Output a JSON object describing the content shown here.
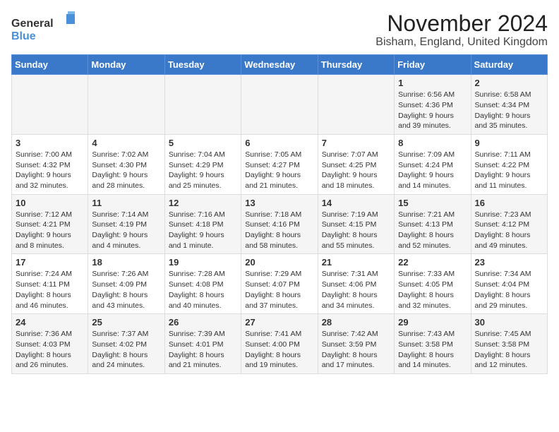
{
  "logo": {
    "text_general": "General",
    "text_blue": "Blue"
  },
  "title": "November 2024",
  "subtitle": "Bisham, England, United Kingdom",
  "columns": [
    "Sunday",
    "Monday",
    "Tuesday",
    "Wednesday",
    "Thursday",
    "Friday",
    "Saturday"
  ],
  "weeks": [
    [
      {
        "day": "",
        "sunrise": "",
        "sunset": "",
        "daylight": ""
      },
      {
        "day": "",
        "sunrise": "",
        "sunset": "",
        "daylight": ""
      },
      {
        "day": "",
        "sunrise": "",
        "sunset": "",
        "daylight": ""
      },
      {
        "day": "",
        "sunrise": "",
        "sunset": "",
        "daylight": ""
      },
      {
        "day": "",
        "sunrise": "",
        "sunset": "",
        "daylight": ""
      },
      {
        "day": "1",
        "sunrise": "Sunrise: 6:56 AM",
        "sunset": "Sunset: 4:36 PM",
        "daylight": "Daylight: 9 hours and 39 minutes."
      },
      {
        "day": "2",
        "sunrise": "Sunrise: 6:58 AM",
        "sunset": "Sunset: 4:34 PM",
        "daylight": "Daylight: 9 hours and 35 minutes."
      }
    ],
    [
      {
        "day": "3",
        "sunrise": "Sunrise: 7:00 AM",
        "sunset": "Sunset: 4:32 PM",
        "daylight": "Daylight: 9 hours and 32 minutes."
      },
      {
        "day": "4",
        "sunrise": "Sunrise: 7:02 AM",
        "sunset": "Sunset: 4:30 PM",
        "daylight": "Daylight: 9 hours and 28 minutes."
      },
      {
        "day": "5",
        "sunrise": "Sunrise: 7:04 AM",
        "sunset": "Sunset: 4:29 PM",
        "daylight": "Daylight: 9 hours and 25 minutes."
      },
      {
        "day": "6",
        "sunrise": "Sunrise: 7:05 AM",
        "sunset": "Sunset: 4:27 PM",
        "daylight": "Daylight: 9 hours and 21 minutes."
      },
      {
        "day": "7",
        "sunrise": "Sunrise: 7:07 AM",
        "sunset": "Sunset: 4:25 PM",
        "daylight": "Daylight: 9 hours and 18 minutes."
      },
      {
        "day": "8",
        "sunrise": "Sunrise: 7:09 AM",
        "sunset": "Sunset: 4:24 PM",
        "daylight": "Daylight: 9 hours and 14 minutes."
      },
      {
        "day": "9",
        "sunrise": "Sunrise: 7:11 AM",
        "sunset": "Sunset: 4:22 PM",
        "daylight": "Daylight: 9 hours and 11 minutes."
      }
    ],
    [
      {
        "day": "10",
        "sunrise": "Sunrise: 7:12 AM",
        "sunset": "Sunset: 4:21 PM",
        "daylight": "Daylight: 9 hours and 8 minutes."
      },
      {
        "day": "11",
        "sunrise": "Sunrise: 7:14 AM",
        "sunset": "Sunset: 4:19 PM",
        "daylight": "Daylight: 9 hours and 4 minutes."
      },
      {
        "day": "12",
        "sunrise": "Sunrise: 7:16 AM",
        "sunset": "Sunset: 4:18 PM",
        "daylight": "Daylight: 9 hours and 1 minute."
      },
      {
        "day": "13",
        "sunrise": "Sunrise: 7:18 AM",
        "sunset": "Sunset: 4:16 PM",
        "daylight": "Daylight: 8 hours and 58 minutes."
      },
      {
        "day": "14",
        "sunrise": "Sunrise: 7:19 AM",
        "sunset": "Sunset: 4:15 PM",
        "daylight": "Daylight: 8 hours and 55 minutes."
      },
      {
        "day": "15",
        "sunrise": "Sunrise: 7:21 AM",
        "sunset": "Sunset: 4:13 PM",
        "daylight": "Daylight: 8 hours and 52 minutes."
      },
      {
        "day": "16",
        "sunrise": "Sunrise: 7:23 AM",
        "sunset": "Sunset: 4:12 PM",
        "daylight": "Daylight: 8 hours and 49 minutes."
      }
    ],
    [
      {
        "day": "17",
        "sunrise": "Sunrise: 7:24 AM",
        "sunset": "Sunset: 4:11 PM",
        "daylight": "Daylight: 8 hours and 46 minutes."
      },
      {
        "day": "18",
        "sunrise": "Sunrise: 7:26 AM",
        "sunset": "Sunset: 4:09 PM",
        "daylight": "Daylight: 8 hours and 43 minutes."
      },
      {
        "day": "19",
        "sunrise": "Sunrise: 7:28 AM",
        "sunset": "Sunset: 4:08 PM",
        "daylight": "Daylight: 8 hours and 40 minutes."
      },
      {
        "day": "20",
        "sunrise": "Sunrise: 7:29 AM",
        "sunset": "Sunset: 4:07 PM",
        "daylight": "Daylight: 8 hours and 37 minutes."
      },
      {
        "day": "21",
        "sunrise": "Sunrise: 7:31 AM",
        "sunset": "Sunset: 4:06 PM",
        "daylight": "Daylight: 8 hours and 34 minutes."
      },
      {
        "day": "22",
        "sunrise": "Sunrise: 7:33 AM",
        "sunset": "Sunset: 4:05 PM",
        "daylight": "Daylight: 8 hours and 32 minutes."
      },
      {
        "day": "23",
        "sunrise": "Sunrise: 7:34 AM",
        "sunset": "Sunset: 4:04 PM",
        "daylight": "Daylight: 8 hours and 29 minutes."
      }
    ],
    [
      {
        "day": "24",
        "sunrise": "Sunrise: 7:36 AM",
        "sunset": "Sunset: 4:03 PM",
        "daylight": "Daylight: 8 hours and 26 minutes."
      },
      {
        "day": "25",
        "sunrise": "Sunrise: 7:37 AM",
        "sunset": "Sunset: 4:02 PM",
        "daylight": "Daylight: 8 hours and 24 minutes."
      },
      {
        "day": "26",
        "sunrise": "Sunrise: 7:39 AM",
        "sunset": "Sunset: 4:01 PM",
        "daylight": "Daylight: 8 hours and 21 minutes."
      },
      {
        "day": "27",
        "sunrise": "Sunrise: 7:41 AM",
        "sunset": "Sunset: 4:00 PM",
        "daylight": "Daylight: 8 hours and 19 minutes."
      },
      {
        "day": "28",
        "sunrise": "Sunrise: 7:42 AM",
        "sunset": "Sunset: 3:59 PM",
        "daylight": "Daylight: 8 hours and 17 minutes."
      },
      {
        "day": "29",
        "sunrise": "Sunrise: 7:43 AM",
        "sunset": "Sunset: 3:58 PM",
        "daylight": "Daylight: 8 hours and 14 minutes."
      },
      {
        "day": "30",
        "sunrise": "Sunrise: 7:45 AM",
        "sunset": "Sunset: 3:58 PM",
        "daylight": "Daylight: 8 hours and 12 minutes."
      }
    ]
  ]
}
